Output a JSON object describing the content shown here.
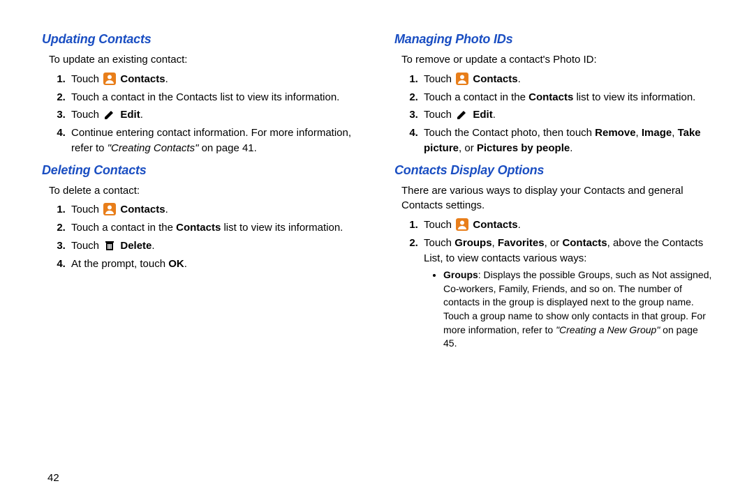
{
  "page_number": "42",
  "left": {
    "section1": {
      "heading": "Updating Contacts",
      "intro": "To update an existing contact:",
      "steps": {
        "s1a": "Touch ",
        "s1b": "Contacts",
        "s1c": ".",
        "s2": "Touch a contact in the Contacts list to view its information.",
        "s3a": "Touch ",
        "s3b": "Edit",
        "s3c": ".",
        "s4a": "Continue entering contact information. For more information, refer to ",
        "s4b": "\"Creating Contacts\"",
        "s4c": " on page 41."
      }
    },
    "section2": {
      "heading": "Deleting Contacts",
      "intro": "To delete a contact:",
      "steps": {
        "s1a": "Touch ",
        "s1b": "Contacts",
        "s1c": ".",
        "s2a": "Touch a contact in the ",
        "s2b": "Contacts",
        "s2c": " list to view its information.",
        "s3a": "Touch ",
        "s3b": "Delete",
        "s3c": ".",
        "s4a": "At the prompt, touch ",
        "s4b": "OK",
        "s4c": "."
      }
    }
  },
  "right": {
    "section1": {
      "heading": "Managing Photo IDs",
      "intro": "To remove or update a contact's Photo ID:",
      "steps": {
        "s1a": "Touch ",
        "s1b": "Contacts",
        "s1c": ".",
        "s2a": "Touch a contact in the ",
        "s2b": "Contacts",
        "s2c": " list to view its information.",
        "s3a": "Touch ",
        "s3b": "Edit",
        "s3c": ".",
        "s4a": "Touch the Contact photo, then touch ",
        "s4b": "Remove",
        "s4c": ", ",
        "s4d": "Image",
        "s4e": ", ",
        "s4f": "Take picture",
        "s4g": ", or ",
        "s4h": "Pictures by people",
        "s4i": "."
      }
    },
    "section2": {
      "heading": "Contacts Display Options",
      "intro": "There are various ways to display your Contacts and general Contacts settings.",
      "steps": {
        "s1a": "Touch ",
        "s1b": "Contacts",
        "s1c": ".",
        "s2a": "Touch ",
        "s2b": "Groups",
        "s2c": ", ",
        "s2d": "Favorites",
        "s2e": ", or ",
        "s2f": "Contacts",
        "s2g": ", above the Contacts List, to view contacts various ways:",
        "bullet1a": "Groups",
        "bullet1b": ": Displays the possible Groups, such as Not assigned, Co-workers, Family, Friends, and so on. The number of contacts in the group is displayed next to the group name. Touch a group name to show only contacts in that group. For more information, refer to ",
        "bullet1c": "\"Creating a New Group\"",
        "bullet1d": " on page 45."
      }
    }
  }
}
